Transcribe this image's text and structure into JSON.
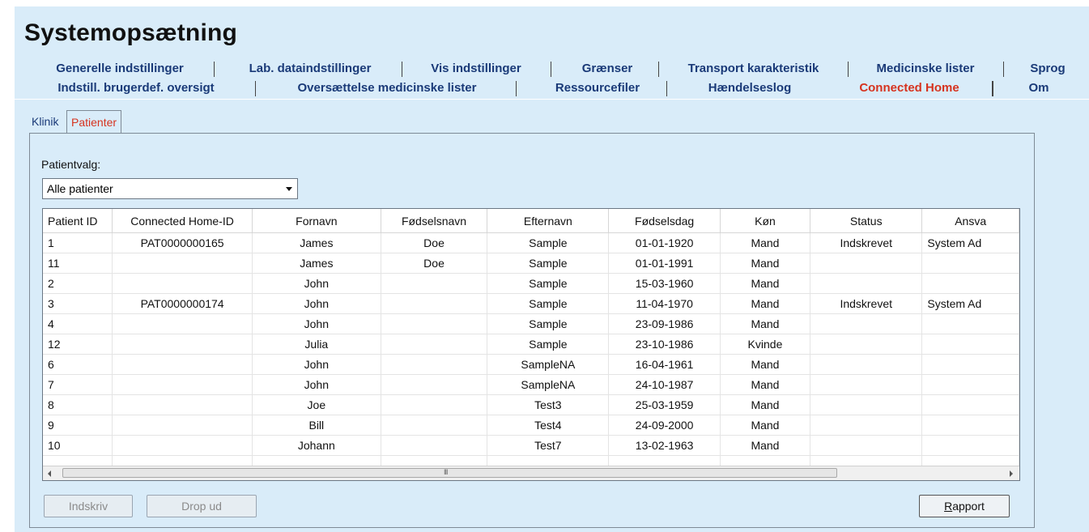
{
  "window": {
    "title": "Systemopsætning"
  },
  "tabs_row1": [
    "Generelle indstillinger",
    "Lab. dataindstillinger",
    "Vis indstillinger",
    "Grænser",
    "Transport karakteristik",
    "Medicinske lister",
    "Sprog"
  ],
  "tabs_row2": [
    "Indstill. brugerdef. oversigt",
    "Oversættelse medicinske lister",
    "Ressourcefiler",
    "Hændelseslog",
    "Connected Home",
    "Om"
  ],
  "active_tab": "Connected Home",
  "sub_tabs": [
    "Klinik",
    "Patienter"
  ],
  "active_sub_tab": "Patienter",
  "patient_select": {
    "label": "Patientvalg:",
    "value": "Alle patienter"
  },
  "table": {
    "columns": [
      "Patient ID",
      "Connected Home-ID",
      "Fornavn",
      "Fødselsnavn",
      "Efternavn",
      "Fødselsdag",
      "Køn",
      "Status",
      "Ansva"
    ],
    "rows": [
      [
        "1",
        "PAT0000000165",
        "James",
        "Doe",
        "Sample",
        "01-01-1920",
        "Mand",
        "Indskrevet",
        "System Ad"
      ],
      [
        "11",
        "",
        "James",
        "Doe",
        "Sample",
        "01-01-1991",
        "Mand",
        "",
        ""
      ],
      [
        "2",
        "",
        "John",
        "",
        "Sample",
        "15-03-1960",
        "Mand",
        "",
        ""
      ],
      [
        "3",
        "PAT0000000174",
        "John",
        "",
        "Sample",
        "11-04-1970",
        "Mand",
        "Indskrevet",
        "System Ad"
      ],
      [
        "4",
        "",
        "John",
        "",
        "Sample",
        "23-09-1986",
        "Mand",
        "",
        ""
      ],
      [
        "12",
        "",
        "Julia",
        "",
        "Sample",
        "23-10-1986",
        "Kvinde",
        "",
        ""
      ],
      [
        "6",
        "",
        "John",
        "",
        "SampleNA",
        "16-04-1961",
        "Mand",
        "",
        ""
      ],
      [
        "7",
        "",
        "John",
        "",
        "SampleNA",
        "24-10-1987",
        "Mand",
        "",
        ""
      ],
      [
        "8",
        "",
        "Joe",
        "",
        "Test3",
        "25-03-1959",
        "Mand",
        "",
        ""
      ],
      [
        "9",
        "",
        "Bill",
        "",
        "Test4",
        "24-09-2000",
        "Mand",
        "",
        ""
      ],
      [
        "10",
        "",
        "Johann",
        "",
        "Test7",
        "13-02-1963",
        "Mand",
        "",
        ""
      ]
    ]
  },
  "scrollbar": {
    "grip": "III"
  },
  "buttons": {
    "enroll": "Indskriv",
    "drop": "Drop ud",
    "report_first": "R",
    "report_rest": "apport"
  },
  "colors": {
    "background": "#d9ecf9",
    "tab_text": "#1a3a78",
    "active_tab_text": "#d6331f"
  }
}
